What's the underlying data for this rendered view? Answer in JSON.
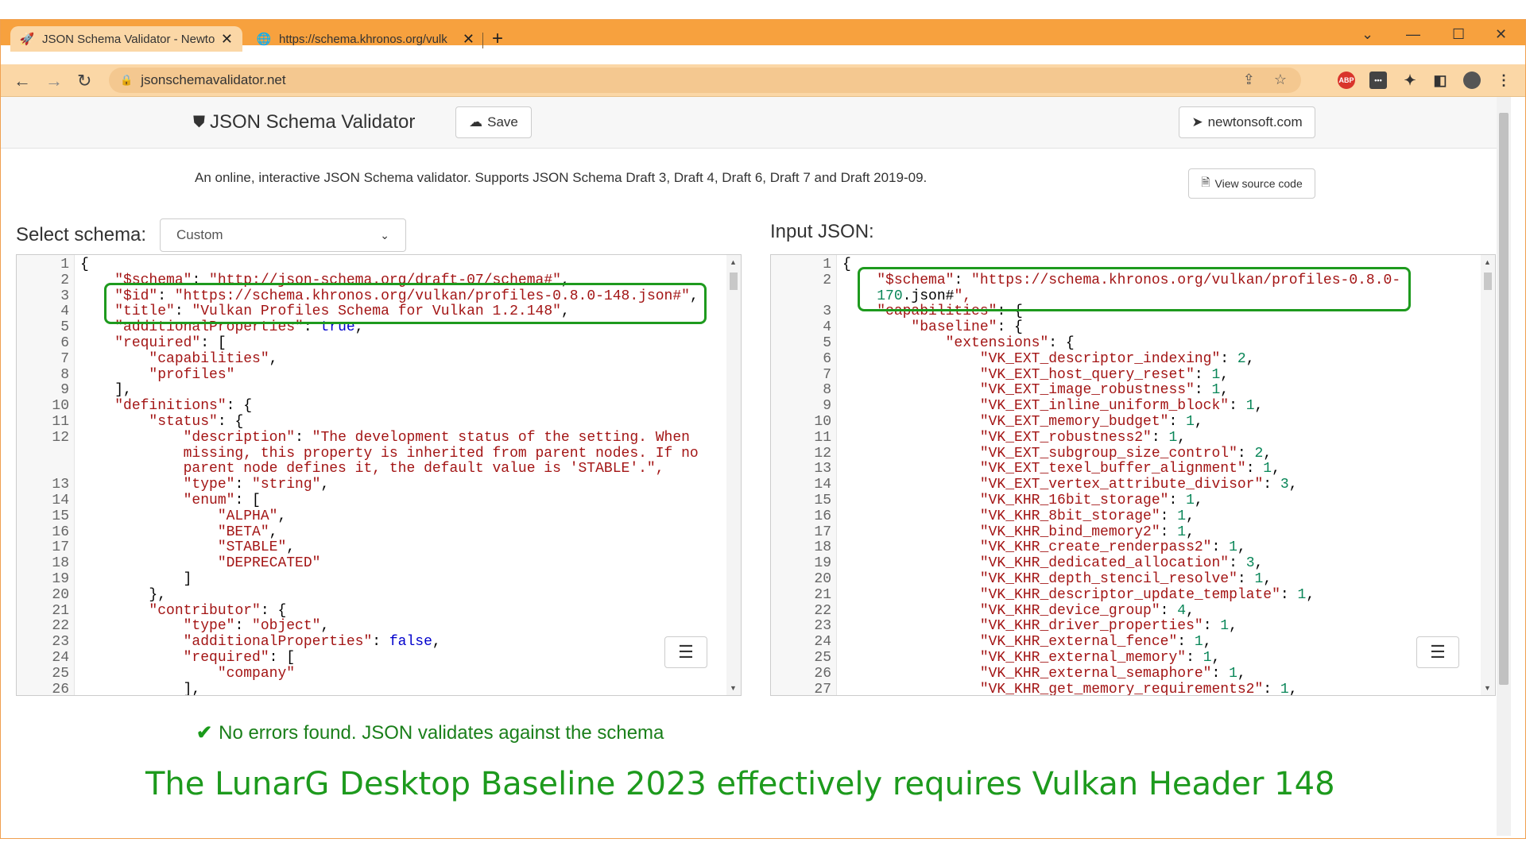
{
  "browser": {
    "tabs": [
      {
        "title": "JSON Schema Validator - Newtor",
        "icon": "rocket-icon",
        "active": true
      },
      {
        "title": "https://schema.khronos.org/vulk",
        "icon": "globe-icon",
        "active": false
      }
    ],
    "url": "jsonschemavalidator.net",
    "colors": {
      "titlebar": "#f7a13e",
      "toolbar": "#fbd7a6"
    }
  },
  "header": {
    "brand": "JSON Schema Validator",
    "save_label": "Save",
    "site_label": "newtonsoft.com"
  },
  "intro": {
    "description": "An online, interactive JSON Schema validator. Supports JSON Schema Draft 3, Draft 4, Draft 6, Draft 7 and Draft 2019-09.",
    "view_source_label": "View source code"
  },
  "schema": {
    "label": "Select schema:",
    "selected": "Custom",
    "lines": [
      "{",
      "    \"$schema\": \"http://json-schema.org/draft-07/schema#\",",
      "    \"$id\": \"https://schema.khronos.org/vulkan/profiles-0.8.0-148.json#\",",
      "    \"title\": \"Vulkan Profiles Schema for Vulkan 1.2.148\",",
      "    \"additionalProperties\": true,",
      "    \"required\": [",
      "        \"capabilities\",",
      "        \"profiles\"",
      "    ],",
      "    \"definitions\": {",
      "        \"status\": {",
      "            \"description\": \"The development status of the setting. When",
      "            missing, this property is inherited from parent nodes. If no",
      "            parent node defines it, the default value is 'STABLE'.\",",
      "            \"type\": \"string\",",
      "            \"enum\": [",
      "                \"ALPHA\",",
      "                \"BETA\",",
      "                \"STABLE\",",
      "                \"DEPRECATED\"",
      "            ]",
      "        },",
      "        \"contributor\": {",
      "            \"type\": \"object\",",
      "            \"additionalProperties\": false,",
      "            \"required\": [",
      "                \"company\"",
      "            ],"
    ],
    "line_numbers": [
      "1",
      "2",
      "3",
      "4",
      "5",
      "6",
      "7",
      "8",
      "9",
      "10",
      "11",
      "12",
      "",
      "",
      "13",
      "14",
      "15",
      "16",
      "17",
      "18",
      "19",
      "20",
      "21",
      "22",
      "23",
      "24",
      "25",
      "26"
    ]
  },
  "input": {
    "label": "Input JSON:",
    "lines": [
      "{",
      "    \"$schema\": \"https://schema.khronos.org/vulkan/profiles-0.8.0-",
      "    170.json#\",",
      "    \"capabilities\": {",
      "        \"baseline\": {",
      "            \"extensions\": {",
      "                \"VK_EXT_descriptor_indexing\": 2,",
      "                \"VK_EXT_host_query_reset\": 1,",
      "                \"VK_EXT_image_robustness\": 1,",
      "                \"VK_EXT_inline_uniform_block\": 1,",
      "                \"VK_EXT_memory_budget\": 1,",
      "                \"VK_EXT_robustness2\": 1,",
      "                \"VK_EXT_subgroup_size_control\": 2,",
      "                \"VK_EXT_texel_buffer_alignment\": 1,",
      "                \"VK_EXT_vertex_attribute_divisor\": 3,",
      "                \"VK_KHR_16bit_storage\": 1,",
      "                \"VK_KHR_8bit_storage\": 1,",
      "                \"VK_KHR_bind_memory2\": 1,",
      "                \"VK_KHR_create_renderpass2\": 1,",
      "                \"VK_KHR_dedicated_allocation\": 3,",
      "                \"VK_KHR_depth_stencil_resolve\": 1,",
      "                \"VK_KHR_descriptor_update_template\": 1,",
      "                \"VK_KHR_device_group\": 4,",
      "                \"VK_KHR_driver_properties\": 1,",
      "                \"VK_KHR_external_fence\": 1,",
      "                \"VK_KHR_external_memory\": 1,",
      "                \"VK_KHR_external_semaphore\": 1,",
      "                \"VK_KHR_get_memory_requirements2\": 1,"
    ],
    "line_numbers": [
      "1",
      "2",
      "",
      "3",
      "4",
      "5",
      "6",
      "7",
      "8",
      "9",
      "10",
      "11",
      "12",
      "13",
      "14",
      "15",
      "16",
      "17",
      "18",
      "19",
      "20",
      "21",
      "22",
      "23",
      "24",
      "25",
      "26",
      "27"
    ]
  },
  "result": {
    "message": "No errors found. JSON validates against the schema",
    "status_color": "#1a9a1a"
  },
  "caption": "The LunarG Desktop Baseline 2023 effectively requires Vulkan Header 148",
  "highlight_color": "#1e9a1e"
}
